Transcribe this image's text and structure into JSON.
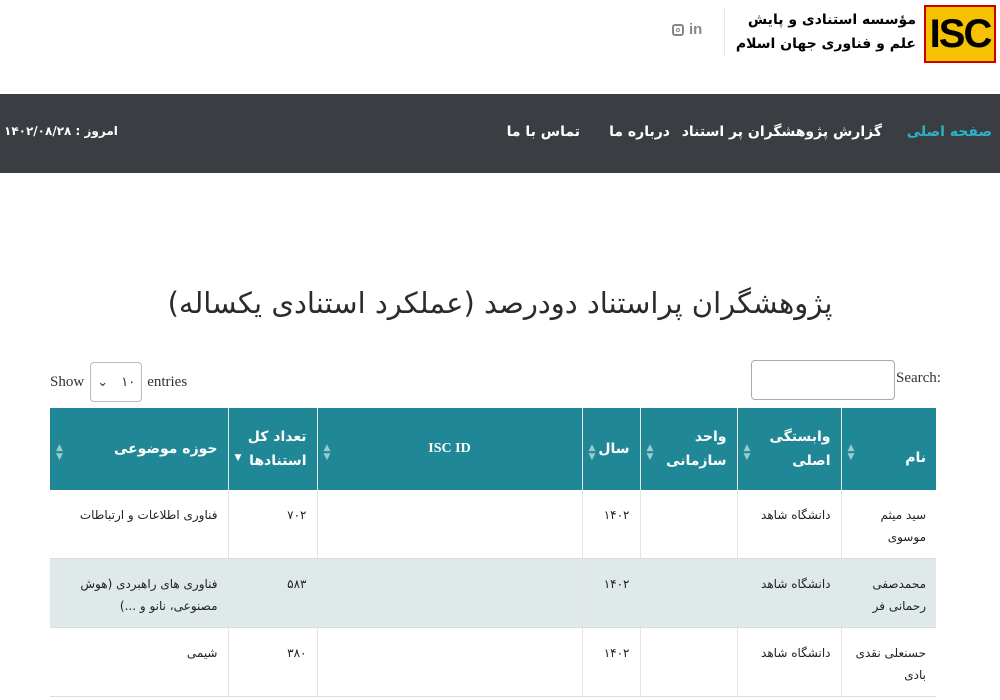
{
  "header": {
    "logo_text": "ISC",
    "org_name_line1": "مؤسسه استنادی و پایش",
    "org_name_line2": "علم و فناوری جهان اسلام",
    "social": {
      "instagram": "instagram-icon",
      "linkedin_text": "in"
    }
  },
  "nav": {
    "items": [
      {
        "label": "صفحه اصلی",
        "active": true
      },
      {
        "label": "گزارش پژوهشگران پر استناد",
        "active": false
      },
      {
        "label": "درباره ما",
        "active": false
      },
      {
        "label": "تماس با ما",
        "active": false
      }
    ],
    "today": "امروز : ۱۴۰۲/۰۸/۲۸"
  },
  "page": {
    "title": "پژوهشگران پراستناد دودرصد (عملکرد استنادی یکساله)"
  },
  "controls": {
    "show_label": "Show",
    "entries_value": "۱۰",
    "entries_label": "entries",
    "search_label": "Search:",
    "search_value": ""
  },
  "table": {
    "columns": [
      {
        "label1": "نام",
        "label2": ""
      },
      {
        "label1": "وابستگی",
        "label2": "اصلی"
      },
      {
        "label1": "واحد",
        "label2": "سازمانی"
      },
      {
        "label1": "سال",
        "label2": ""
      },
      {
        "label1": "ISC ID",
        "label2": ""
      },
      {
        "label1": "تعداد کل",
        "label2": "استنادها"
      },
      {
        "label1": "حوزه موضوعی",
        "label2": ""
      }
    ],
    "rows": [
      {
        "name": "سید میثم موسوی",
        "affiliation": "دانشگاه شاهد",
        "unit": "",
        "year": "۱۴۰۲",
        "isc_id": "",
        "citations": "۷۰۲",
        "field": "فناوری اطلاعات و ارتباطات"
      },
      {
        "name": "محمدصفی رحمانی فر",
        "affiliation": "دانشگاه شاهد",
        "unit": "",
        "year": "۱۴۰۲",
        "isc_id": "",
        "citations": "۵۸۳",
        "field": "فناوری های راهبردی (هوش مصنوعی، نانو و ...)"
      },
      {
        "name": "حسنعلی نقدی بادی",
        "affiliation": "دانشگاه شاهد",
        "unit": "",
        "year": "۱۴۰۲",
        "isc_id": "",
        "citations": "۳۸۰",
        "field": "شیمی"
      }
    ]
  },
  "colors": {
    "nav_bg": "#3a3e43",
    "nav_active": "#2ab4c6",
    "table_header": "#1f8796",
    "row_alt": "#dfe9ea",
    "logo_yellow": "#f5c100"
  }
}
